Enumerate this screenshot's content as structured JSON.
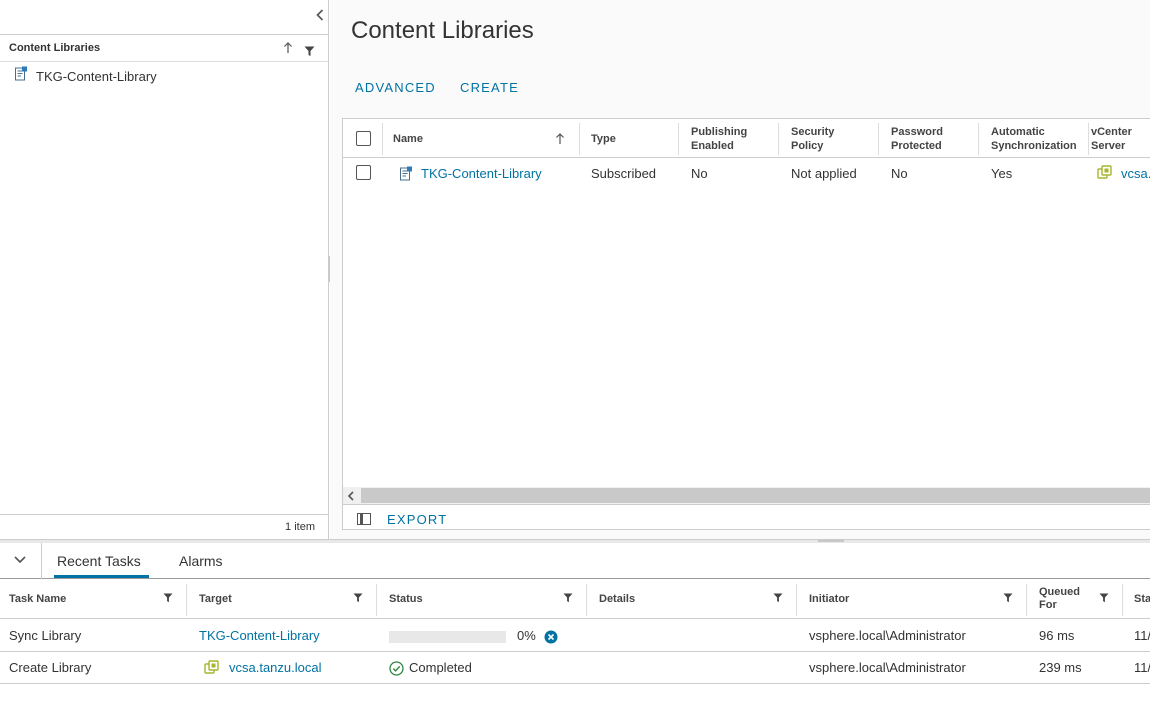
{
  "left_panel": {
    "header_title": "Content Libraries",
    "items": [
      {
        "label": "TKG-Content-Library",
        "icon": "content-library-icon"
      }
    ],
    "footer_count": "1 item"
  },
  "main": {
    "title": "Content Libraries",
    "actions": {
      "advanced": "ADVANCED",
      "create": "CREATE"
    },
    "grid": {
      "columns": {
        "name": "Name",
        "type": "Type",
        "publishing_1": "Publishing",
        "publishing_2": "Enabled",
        "security_1": "Security",
        "security_2": "Policy",
        "password_1": "Password",
        "password_2": "Protected",
        "auto_1": "Automatic",
        "auto_2": "Synchronization",
        "vcenter_1": "vCenter",
        "vcenter_2": "Server"
      },
      "rows": [
        {
          "name": "TKG-Content-Library",
          "type": "Subscribed",
          "publishing_enabled": "No",
          "security_policy": "Not applied",
          "password_protected": "No",
          "automatic_sync": "Yes",
          "vcenter_server": "vcsa."
        }
      ],
      "export_label": "EXPORT"
    }
  },
  "bottom": {
    "tabs": {
      "recent_tasks": "Recent Tasks",
      "alarms": "Alarms"
    },
    "columns": {
      "task_name": "Task Name",
      "target": "Target",
      "status": "Status",
      "details": "Details",
      "initiator": "Initiator",
      "queued_1": "Queued",
      "queued_2": "For",
      "start": "Sta"
    },
    "tasks": [
      {
        "task_name": "Sync Library",
        "target": "TKG-Content-Library",
        "status_text": "0%",
        "progress": 0,
        "details": "",
        "initiator": "vsphere.local\\Administrator",
        "queued_for": "96 ms",
        "start": "11/"
      },
      {
        "task_name": "Create Library",
        "target": "vcsa.tanzu.local",
        "status_text": "Completed",
        "details": "",
        "initiator": "vsphere.local\\Administrator",
        "queued_for": "239 ms",
        "start": "11/"
      }
    ]
  },
  "colors": {
    "accent": "#0072a3",
    "link": "#0072a3",
    "cancel": "#0072a3",
    "success": "#2e8540",
    "vcenter_icon": "#a6b52d"
  }
}
